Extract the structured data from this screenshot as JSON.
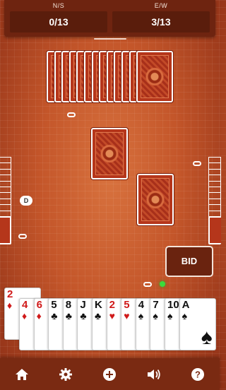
{
  "score": {
    "ns_label": "N/S",
    "ns_value": "0/13",
    "ew_label": "E/W",
    "ew_value": "3/13"
  },
  "dealer_chip": "D",
  "bid_button": "BID",
  "north_cards_count": 13,
  "hand": [
    {
      "rank": "2",
      "suit": "♦",
      "color": "red"
    },
    {
      "rank": "4",
      "suit": "♦",
      "color": "red"
    },
    {
      "rank": "6",
      "suit": "♦",
      "color": "red"
    },
    {
      "rank": "5",
      "suit": "♣",
      "color": "black"
    },
    {
      "rank": "8",
      "suit": "♣",
      "color": "black"
    },
    {
      "rank": "J",
      "suit": "♣",
      "color": "black"
    },
    {
      "rank": "K",
      "suit": "♣",
      "color": "black"
    },
    {
      "rank": "2",
      "suit": "♥",
      "color": "red"
    },
    {
      "rank": "5",
      "suit": "♥",
      "color": "red"
    },
    {
      "rank": "4",
      "suit": "♠",
      "color": "black"
    },
    {
      "rank": "7",
      "suit": "♠",
      "color": "black"
    },
    {
      "rank": "10",
      "suit": "♠",
      "color": "black"
    },
    {
      "rank": "A",
      "suit": "♠",
      "color": "black"
    }
  ],
  "nav": [
    {
      "name": "home-icon"
    },
    {
      "name": "gear-icon"
    },
    {
      "name": "plus-icon"
    },
    {
      "name": "speaker-icon"
    },
    {
      "name": "help-icon"
    }
  ],
  "colors": {
    "table": "#c4562a",
    "panel": "#6e2410",
    "nav_bar": "#7a2a12",
    "turn_indicator": "#3bdc3b"
  }
}
